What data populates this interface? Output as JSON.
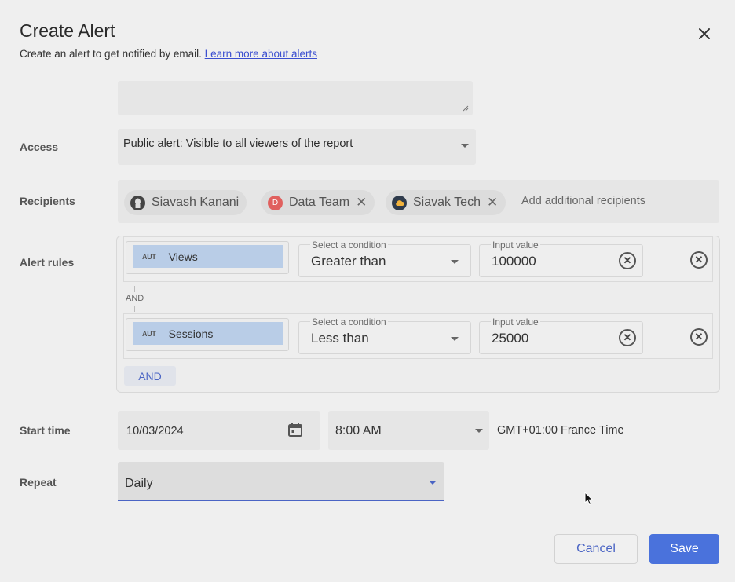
{
  "dialog": {
    "title": "Create Alert",
    "subtitle": "Create an alert to get notified by email.",
    "learn_more_link": "Learn more about alerts"
  },
  "access": {
    "label": "Access",
    "value": "Public alert: Visible to all viewers of the report"
  },
  "recipients": {
    "label": "Recipients",
    "chips": [
      {
        "name": "Siavash Kanani",
        "avatar_color": "#444444",
        "removable": false
      },
      {
        "name": "Data Team",
        "avatar_color": "#e0605e",
        "avatar_text": "D",
        "removable": true
      },
      {
        "name": "Siavak Tech",
        "avatar_color": "#2f3b4c",
        "removable": true
      }
    ],
    "placeholder": "Add additional recipients"
  },
  "alert_rules": {
    "label": "Alert rules",
    "metric_type_tag": "AUT",
    "condition_label": "Select a condition",
    "input_label": "Input value",
    "rules": [
      {
        "metric": "Views",
        "condition": "Greater than",
        "value": "100000"
      },
      {
        "metric": "Sessions",
        "condition": "Less than",
        "value": "25000"
      }
    ],
    "joiner": "AND",
    "add_button": "AND"
  },
  "start_time": {
    "label": "Start time",
    "date": "10/03/2024",
    "time": "8:00 AM",
    "timezone": "GMT+01:00 France Time"
  },
  "repeat": {
    "label": "Repeat",
    "value": "Daily"
  },
  "footer": {
    "cancel_label": "Cancel",
    "save_label": "Save"
  },
  "colors": {
    "accent": "#4a72dc",
    "metric_chip": "#b9cde7",
    "link": "#3b4fd0"
  }
}
